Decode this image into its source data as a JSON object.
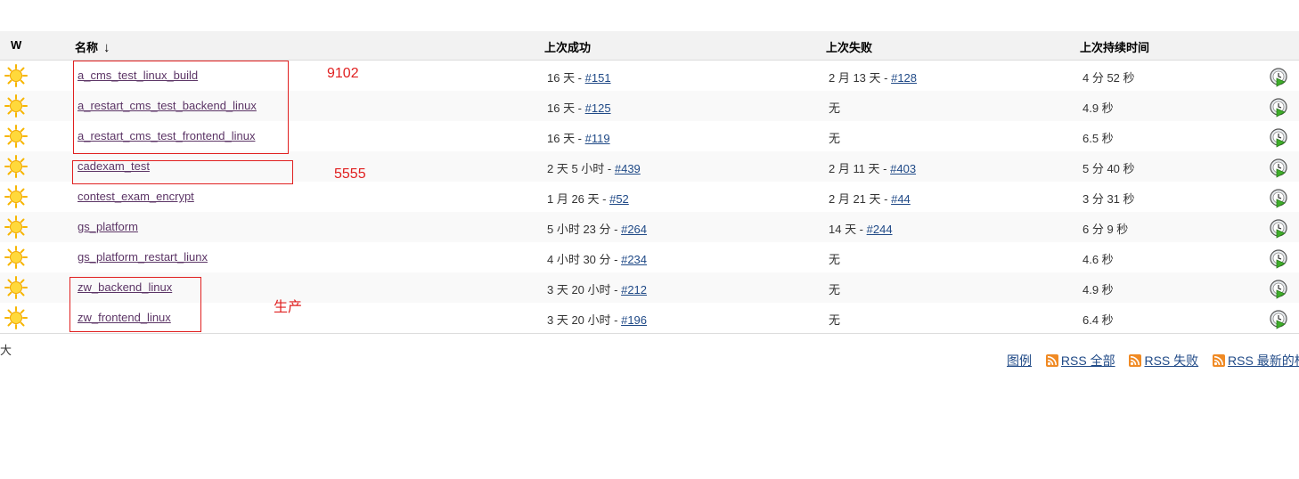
{
  "table": {
    "headers": {
      "w": "W",
      "name": "名称",
      "sort_indicator": "↓",
      "last_success": "上次成功",
      "last_failure": "上次失败",
      "last_duration": "上次持续时间"
    },
    "rows": [
      {
        "name": "a_cms_test_linux_build",
        "success_prefix": "16 天 - ",
        "success_build": "#151",
        "failure_prefix": "2 月 13 天 - ",
        "failure_build": "#128",
        "duration": "4 分 52 秒"
      },
      {
        "name": "a_restart_cms_test_backend_linux",
        "success_prefix": "16 天 - ",
        "success_build": "#125",
        "failure_prefix": "无",
        "failure_build": "",
        "duration": "4.9 秒"
      },
      {
        "name": "a_restart_cms_test_frontend_linux",
        "success_prefix": "16 天 - ",
        "success_build": "#119",
        "failure_prefix": "无",
        "failure_build": "",
        "duration": "6.5 秒"
      },
      {
        "name": "cadexam_test",
        "success_prefix": "2 天 5 小时 - ",
        "success_build": "#439",
        "failure_prefix": "2 月 11 天 - ",
        "failure_build": "#403",
        "duration": "5 分 40 秒"
      },
      {
        "name": "contest_exam_encrypt",
        "success_prefix": "1 月 26 天 - ",
        "success_build": "#52",
        "failure_prefix": "2 月 21 天 - ",
        "failure_build": "#44",
        "duration": "3 分 31 秒"
      },
      {
        "name": "gs_platform",
        "success_prefix": "5 小时 23 分 - ",
        "success_build": "#264",
        "failure_prefix": "14 天 - ",
        "failure_build": "#244",
        "duration": "6 分 9 秒"
      },
      {
        "name": "gs_platform_restart_liunx",
        "success_prefix": "4 小时 30 分 - ",
        "success_build": "#234",
        "failure_prefix": "无",
        "failure_build": "",
        "duration": "4.6 秒"
      },
      {
        "name": "zw_backend_linux",
        "success_prefix": "3 天 20 小时 - ",
        "success_build": "#212",
        "failure_prefix": "无",
        "failure_build": "",
        "duration": "4.9 秒"
      },
      {
        "name": "zw_frontend_linux",
        "success_prefix": "3 天 20 小时 - ",
        "success_build": "#196",
        "failure_prefix": "无",
        "failure_build": "",
        "duration": "6.4 秒"
      }
    ]
  },
  "annotations": {
    "group1": "9102",
    "group2": "5555",
    "group3": "生产"
  },
  "footer": {
    "size_label": "大",
    "legend": "图例",
    "rss_all": "RSS 全部",
    "rss_failed": "RSS 失败",
    "rss_latest": "RSS 最新的构建"
  },
  "colors": {
    "annotation": "#e02020",
    "link": "#204a87",
    "job_link": "#5c3566",
    "header_bg": "#f2f2f2"
  },
  "icons": {
    "weather": "sun-icon",
    "build": "schedule-build-icon",
    "rss": "rss-icon"
  }
}
